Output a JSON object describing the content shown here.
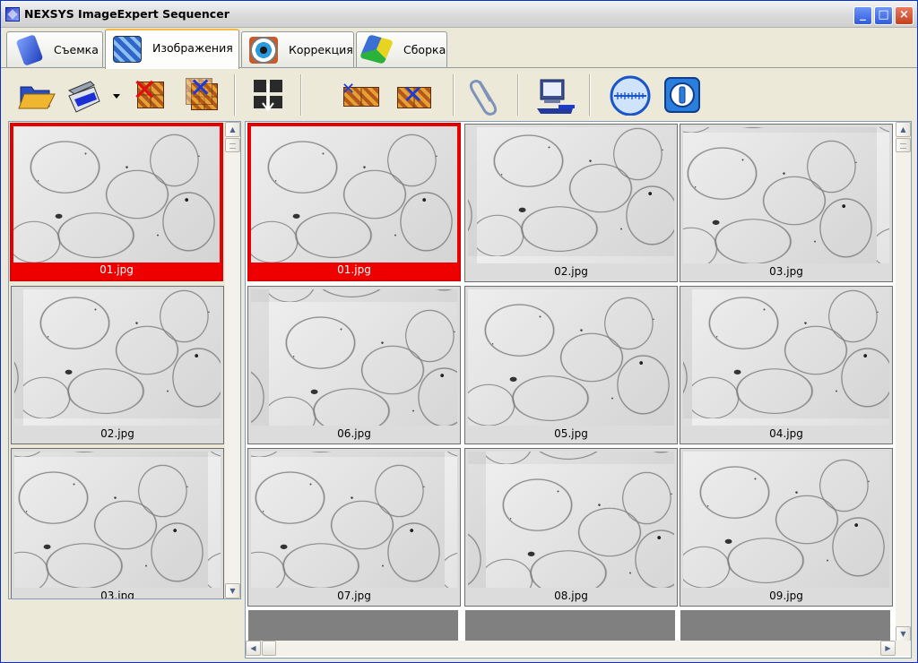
{
  "window": {
    "title": "NEXSYS ImageExpert Sequencer",
    "minimize": "_",
    "maximize": "□",
    "close": "×"
  },
  "tabs": [
    {
      "label": "Съемка",
      "icon": "camera-icon",
      "active": false
    },
    {
      "label": "Изображения",
      "icon": "images-icon",
      "active": true
    },
    {
      "label": "Коррекция",
      "icon": "eye-icon",
      "active": false
    },
    {
      "label": "Сборка",
      "icon": "cube-icon",
      "active": false
    }
  ],
  "toolbar": {
    "buttons": [
      {
        "name": "open-folder-button",
        "icon": "folder-open-icon"
      },
      {
        "name": "scanner-button",
        "icon": "scanner-icon"
      },
      {
        "name": "scanner-dropdown-button",
        "icon": "caret-down-icon"
      },
      {
        "name": "delete-image-button",
        "icon": "delete-mosaic-icon"
      },
      {
        "name": "delete-all-button",
        "icon": "delete-stack-icon"
      },
      {
        "name": "arrange-button",
        "icon": "arrange-icon"
      },
      {
        "name": "remove-selected-button",
        "icon": "remove-grid-icon"
      },
      {
        "name": "remove-cross-button",
        "icon": "remove-cross-icon"
      },
      {
        "name": "attach-button",
        "icon": "paperclip-icon"
      },
      {
        "name": "computer-settings-button",
        "icon": "computer-wrench-icon"
      },
      {
        "name": "scale-button",
        "icon": "ruler-scale-icon"
      },
      {
        "name": "info-button",
        "icon": "info-icon"
      }
    ]
  },
  "left_list": {
    "items": [
      {
        "label": "01.jpg",
        "selected": true
      },
      {
        "label": "02.jpg",
        "selected": false
      },
      {
        "label": "03.jpg",
        "selected": false
      }
    ]
  },
  "grid": {
    "items": [
      {
        "label": "01.jpg",
        "selected": true
      },
      {
        "label": "02.jpg",
        "selected": false
      },
      {
        "label": "03.jpg",
        "selected": false
      },
      {
        "label": "06.jpg",
        "selected": false
      },
      {
        "label": "05.jpg",
        "selected": false
      },
      {
        "label": "04.jpg",
        "selected": false
      },
      {
        "label": "07.jpg",
        "selected": false
      },
      {
        "label": "08.jpg",
        "selected": false
      },
      {
        "label": "09.jpg",
        "selected": false
      }
    ]
  },
  "colors": {
    "selection": "#ee0000",
    "titlebar_start": "#f4f4f4",
    "tab_highlight": "#f6b84a"
  }
}
